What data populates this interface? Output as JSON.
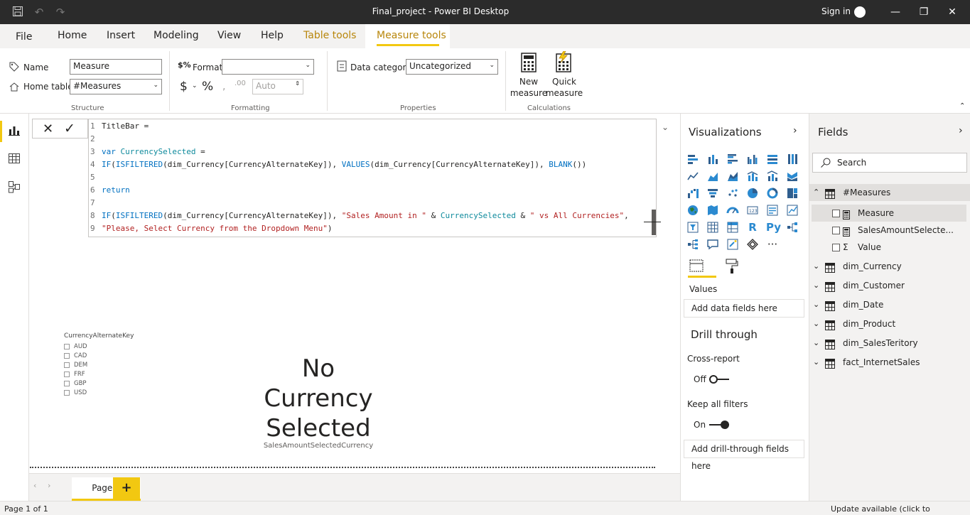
{
  "window": {
    "title": "Final_project - Power BI Desktop",
    "sign_in": "Sign in"
  },
  "ribbon": {
    "tabs": [
      "File",
      "Home",
      "Insert",
      "Modeling",
      "View",
      "Help",
      "Table tools",
      "Measure tools"
    ],
    "active_tab": "Measure tools",
    "structure": {
      "name_label": "Name",
      "name_value": "Measure",
      "home_table_label": "Home table",
      "home_table_value": "#Measures",
      "group_title": "Structure"
    },
    "formatting": {
      "format_label": "Format",
      "format_value": "",
      "currency_symbol": "$",
      "percent_symbol": "%",
      "decimals_value": "Auto",
      "group_title": "Formatting"
    },
    "properties": {
      "data_category_label": "Data category",
      "data_category_value": "Uncategorized",
      "group_title": "Properties"
    },
    "calculations": {
      "new_measure_label": "New measure",
      "quick_measure_label": "Quick measure",
      "new_measure_line1": "New",
      "new_measure_line2": "measure",
      "quick_measure_line1": "Quick",
      "quick_measure_line2": "measure",
      "group_title": "Calculations"
    }
  },
  "editor": {
    "lines": [
      {
        "n": "1",
        "text": "TitleBar ="
      },
      {
        "n": "2",
        "text": ""
      },
      {
        "n": "3",
        "text": "var CurrencySelected ="
      },
      {
        "n": "4",
        "text": "IF(ISFILTERED(dim_Currency[CurrencyAlternateKey]), VALUES(dim_Currency[CurrencyAlternateKey]), BLANK())"
      },
      {
        "n": "5",
        "text": ""
      },
      {
        "n": "6",
        "text": "return"
      },
      {
        "n": "7",
        "text": ""
      },
      {
        "n": "8",
        "text": "IF(ISFILTERED(dim_Currency[CurrencyAlternateKey]), \"Sales Amount in \" & CurrencySelected & \" vs All Currencies\","
      },
      {
        "n": "9",
        "text": "\"Please, Select Currency from the Dropdown Menu\")"
      }
    ]
  },
  "slicer": {
    "title": "CurrencyAlternateKey",
    "items": [
      "AUD",
      "CAD",
      "DEM",
      "FRF",
      "GBP",
      "USD"
    ]
  },
  "card": {
    "line1": "No",
    "line2": "Currency",
    "line3": "Selected",
    "label": "SalesAmountSelectedCurrency"
  },
  "pages": {
    "tabs": [
      "Page 1"
    ],
    "add_label": "+"
  },
  "status": {
    "page_info": "Page 1 of 1",
    "update": "Update available (click to download)"
  },
  "visualizations": {
    "title": "Visualizations",
    "values_label": "Values",
    "add_data_fields": "Add data fields here",
    "drill_through": "Drill through",
    "cross_report": "Cross-report",
    "cross_report_state": "Off",
    "keep_all_filters": "Keep all filters",
    "keep_all_filters_state": "On",
    "add_drill_through": "Add drill-through fields here",
    "r_label": "R",
    "py_label": "Py",
    "more_label": "···"
  },
  "fields": {
    "title": "Fields",
    "search_placeholder": "Search",
    "tables": [
      {
        "name": "#Measures",
        "expanded": true,
        "children": [
          {
            "name": "Measure",
            "kind": "calc"
          },
          {
            "name": "SalesAmountSelecte...",
            "kind": "calc"
          },
          {
            "name": "Value",
            "kind": "sigma"
          }
        ]
      },
      {
        "name": "dim_Currency"
      },
      {
        "name": "dim_Customer"
      },
      {
        "name": "dim_Date"
      },
      {
        "name": "dim_Product"
      },
      {
        "name": "dim_SalesTeritory"
      },
      {
        "name": "fact_InternetSales"
      }
    ]
  },
  "colors": {
    "accent": "#f2c811",
    "titlebar": "#2b2b2b",
    "keyword": "#0070c1",
    "string": "#b22222"
  }
}
